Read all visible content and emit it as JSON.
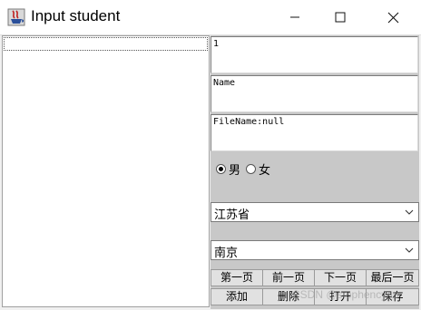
{
  "window": {
    "title": "Input student",
    "minimize_icon": "minimize-icon",
    "maximize_icon": "maximize-icon",
    "close_icon": "close-icon"
  },
  "form": {
    "id_value": "1",
    "name_value": "Name",
    "filename_value": "FileName:null",
    "gender": {
      "options": [
        {
          "label": "男",
          "checked": true
        },
        {
          "label": "女",
          "checked": false
        }
      ]
    },
    "province": "江苏省",
    "city": "南京"
  },
  "buttons": {
    "first": "第一页",
    "prev": "前一页",
    "next": "下一页",
    "last": "最后一页",
    "add": "添加",
    "delete": "删除",
    "open": "打开",
    "save": "保存"
  },
  "watermark": "CSDN @stephencyan"
}
